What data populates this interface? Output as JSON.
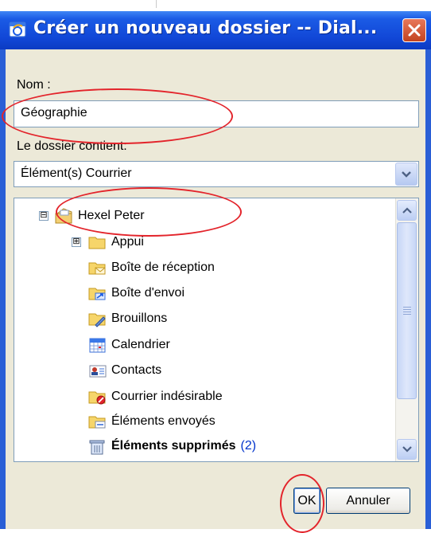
{
  "window": {
    "title": "Créer un nouveau dossier -- Dial...",
    "close_symbol": "✕"
  },
  "form": {
    "name_label": "Nom :",
    "name_value": "Géographie",
    "contains_label": "Le dossier contient:",
    "contains_value": "Élément(s) Courrier"
  },
  "tree": {
    "items": [
      {
        "label": "Hexel Peter",
        "icon": "mailbox-icon",
        "expander": "⊟"
      },
      {
        "label": "Appui",
        "icon": "folder-icon",
        "expander": "⊞"
      },
      {
        "label": "Boîte de réception",
        "icon": "inbox-folder-icon"
      },
      {
        "label": "Boîte d'envoi",
        "icon": "outbox-folder-icon"
      },
      {
        "label": "Brouillons",
        "icon": "drafts-folder-icon"
      },
      {
        "label": "Calendrier",
        "icon": "calendar-icon"
      },
      {
        "label": "Contacts",
        "icon": "contacts-icon"
      },
      {
        "label": "Courrier indésirable",
        "icon": "junk-mail-folder-icon"
      },
      {
        "label": "Éléments envoyés",
        "icon": "sent-items-folder-icon"
      },
      {
        "label": "Éléments supprimés",
        "count": "(2)",
        "icon": "deleted-items-icon"
      }
    ]
  },
  "buttons": {
    "ok": "OK",
    "cancel": "Annuler"
  },
  "colors": {
    "titlebar": "#1147d7",
    "dialog_bg": "#ece9d8",
    "annotation": "#e3242b",
    "unread_count": "#0033cc"
  }
}
